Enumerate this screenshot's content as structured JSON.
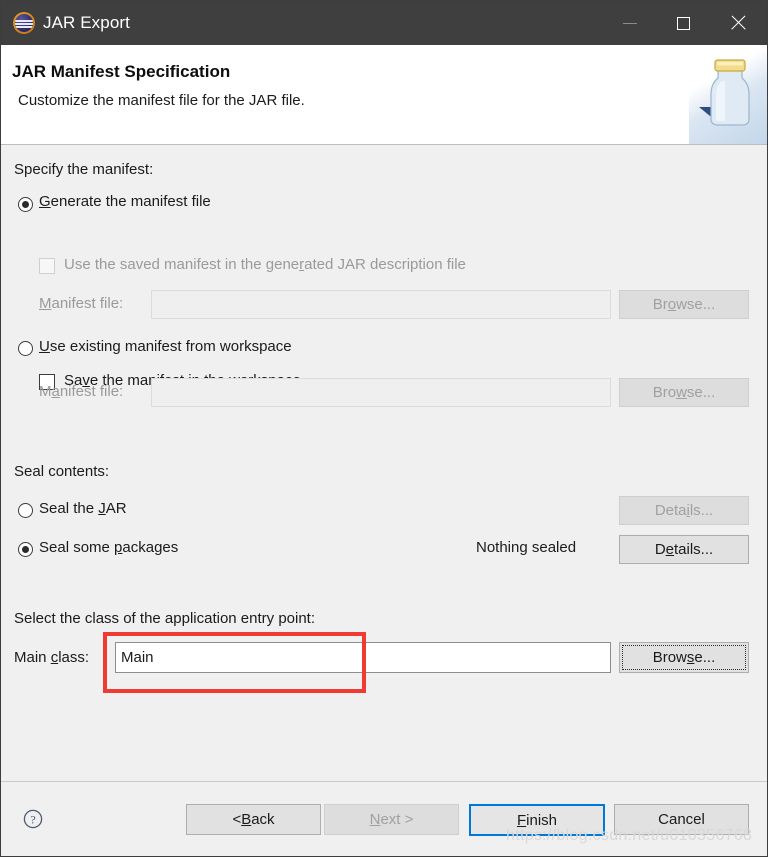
{
  "window": {
    "title": "JAR Export",
    "icon": "eclipse-icon",
    "controls": {
      "minimize": "minimize-icon",
      "maximize": "maximize-icon",
      "close": "close-icon"
    }
  },
  "header": {
    "title": "JAR Manifest Specification",
    "description": "Customize the manifest file for the JAR file.",
    "banner_icon": "jar-bottle-icon"
  },
  "manifest_section": {
    "group_label": "Specify the manifest:",
    "generate_radio": {
      "pre": "",
      "mnemonic": "G",
      "post": "enerate the manifest file",
      "selected": true
    },
    "save_checkbox": {
      "pre": "Sa",
      "mnemonic": "v",
      "post": "e the manifest in the workspace",
      "checked": false,
      "enabled": true
    },
    "use_saved_checkbox": {
      "pre": "Use the saved manifest in the gene",
      "mnemonic": "r",
      "post": "ated JAR description file",
      "checked": false,
      "enabled": false
    },
    "generated_file": {
      "label_pre": "",
      "label_mnemonic": "M",
      "label_post": "anifest file:",
      "value": "",
      "enabled": false,
      "browse": {
        "pre": "Br",
        "mnemonic": "o",
        "post": "wse...",
        "enabled": false
      }
    },
    "use_existing_radio": {
      "pre": "",
      "mnemonic": "U",
      "post": "se existing manifest from workspace",
      "selected": false
    },
    "existing_file": {
      "label_pre": "M",
      "label_mnemonic": "a",
      "label_post": "nifest file:",
      "value": "",
      "enabled": false,
      "browse": {
        "pre": "Bro",
        "mnemonic": "w",
        "post": "se...",
        "enabled": false
      }
    }
  },
  "seal_section": {
    "group_label": "Seal contents:",
    "seal_jar_radio": {
      "pre": "Seal the ",
      "mnemonic": "J",
      "post": "AR",
      "selected": false
    },
    "seal_jar_details": {
      "pre": "Deta",
      "mnemonic": "i",
      "post": "ls...",
      "enabled": false
    },
    "seal_packages_radio": {
      "pre": "Seal some ",
      "mnemonic": "p",
      "post": "ackages",
      "selected": true
    },
    "seal_status": "Nothing sealed",
    "seal_packages_details": {
      "pre": "D",
      "mnemonic": "e",
      "post": "tails...",
      "enabled": true
    }
  },
  "entry_point_section": {
    "group_label": "Select the class of the application entry point:",
    "main_class": {
      "label_pre": "Main ",
      "label_mnemonic": "c",
      "label_post": "lass:",
      "value": "Main",
      "enabled": true
    },
    "browse": {
      "pre": "Brow",
      "mnemonic": "s",
      "post": "e...",
      "enabled": true,
      "focused": true
    }
  },
  "footer": {
    "help_icon": "help-question-icon",
    "back": {
      "pre": "< ",
      "mnemonic": "B",
      "post": "ack",
      "enabled": true
    },
    "next": {
      "pre": "",
      "mnemonic": "N",
      "post": "ext >",
      "enabled": false
    },
    "finish": {
      "pre": "",
      "mnemonic": "F",
      "post": "inish",
      "enabled": true,
      "is_default": true
    },
    "cancel": {
      "pre": "Cancel",
      "mnemonic": "",
      "post": "",
      "enabled": true
    }
  },
  "watermark": "https://blog.csdn.net/u010356768",
  "colors": {
    "titlebar_bg": "#3f3f3f",
    "content_bg": "#f0f0f0",
    "accent_default_button": "#0078d7",
    "annotation_red": "#f03b32"
  }
}
